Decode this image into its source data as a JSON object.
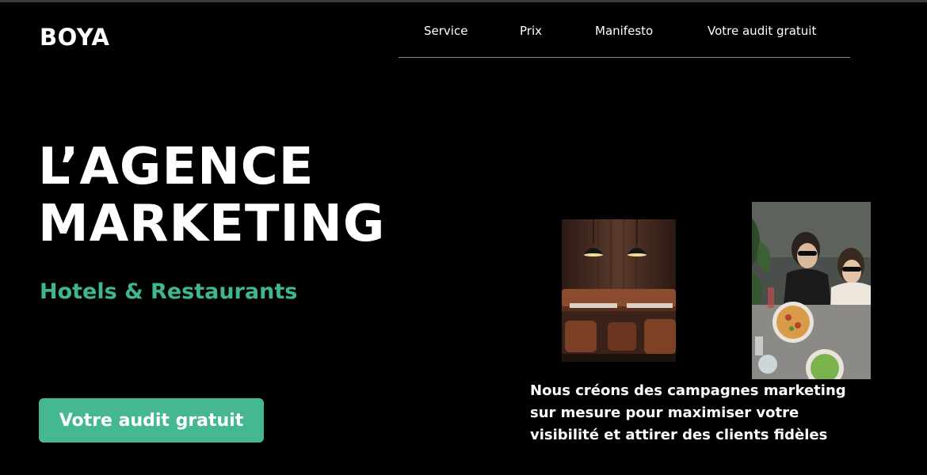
{
  "brand": {
    "logo": "BOYA"
  },
  "nav": {
    "items": [
      {
        "label": "Service"
      },
      {
        "label": "Prix"
      },
      {
        "label": "Manifesto"
      },
      {
        "label": "Votre audit gratuit"
      }
    ]
  },
  "hero": {
    "headline_line1": "L’AGENCE",
    "headline_line2": "MARKETING",
    "subtitle": "Hotels & Restaurants",
    "cta_label": "Votre audit gratuit",
    "description": "Nous créons des campagnes marketing sur mesure pour maximiser votre visibilité et attirer des clients fidèles"
  },
  "colors": {
    "background": "#000000",
    "accent": "#45b791",
    "text": "#ffffff"
  }
}
